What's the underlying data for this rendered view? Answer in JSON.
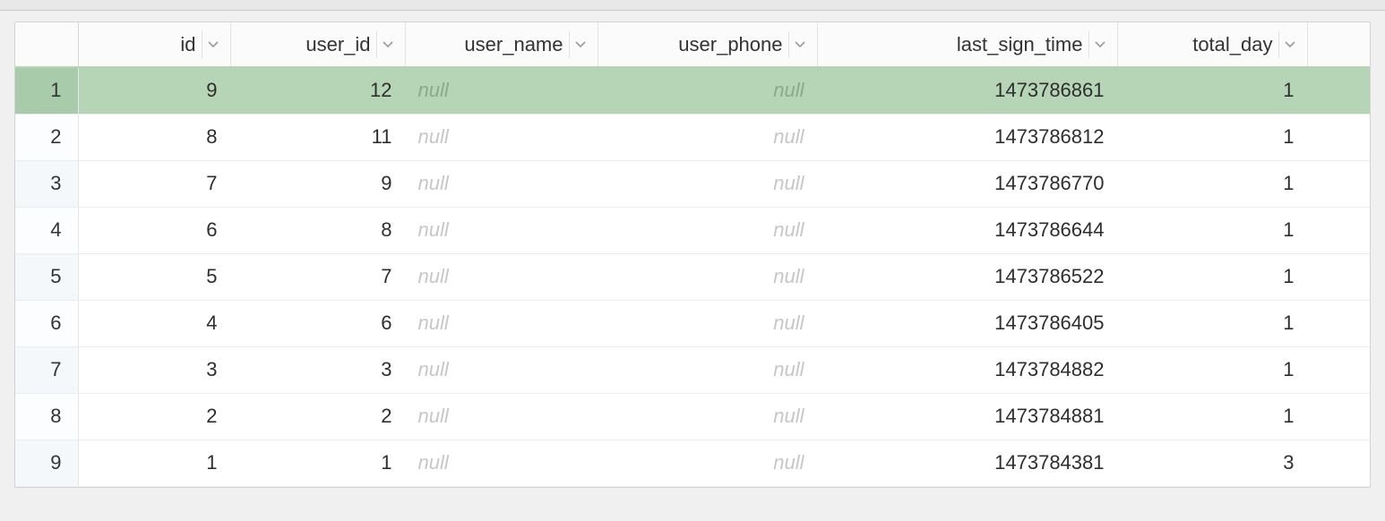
{
  "null_text": "null",
  "columns": [
    {
      "key": "id",
      "label": "id"
    },
    {
      "key": "user_id",
      "label": "user_id"
    },
    {
      "key": "user_name",
      "label": "user_name"
    },
    {
      "key": "user_phone",
      "label": "user_phone"
    },
    {
      "key": "last_sign_time",
      "label": "last_sign_time"
    },
    {
      "key": "total_day",
      "label": "total_day"
    }
  ],
  "rows": [
    {
      "n": "1",
      "id": "9",
      "user_id": "12",
      "user_name": null,
      "user_phone": null,
      "last_sign_time": "1473786861",
      "total_day": "1",
      "selected": true
    },
    {
      "n": "2",
      "id": "8",
      "user_id": "11",
      "user_name": null,
      "user_phone": null,
      "last_sign_time": "1473786812",
      "total_day": "1"
    },
    {
      "n": "3",
      "id": "7",
      "user_id": "9",
      "user_name": null,
      "user_phone": null,
      "last_sign_time": "1473786770",
      "total_day": "1"
    },
    {
      "n": "4",
      "id": "6",
      "user_id": "8",
      "user_name": null,
      "user_phone": null,
      "last_sign_time": "1473786644",
      "total_day": "1"
    },
    {
      "n": "5",
      "id": "5",
      "user_id": "7",
      "user_name": null,
      "user_phone": null,
      "last_sign_time": "1473786522",
      "total_day": "1"
    },
    {
      "n": "6",
      "id": "4",
      "user_id": "6",
      "user_name": null,
      "user_phone": null,
      "last_sign_time": "1473786405",
      "total_day": "1"
    },
    {
      "n": "7",
      "id": "3",
      "user_id": "3",
      "user_name": null,
      "user_phone": null,
      "last_sign_time": "1473784882",
      "total_day": "1"
    },
    {
      "n": "8",
      "id": "2",
      "user_id": "2",
      "user_name": null,
      "user_phone": null,
      "last_sign_time": "1473784881",
      "total_day": "1"
    },
    {
      "n": "9",
      "id": "1",
      "user_id": "1",
      "user_name": null,
      "user_phone": null,
      "last_sign_time": "1473784381",
      "total_day": "3"
    }
  ]
}
